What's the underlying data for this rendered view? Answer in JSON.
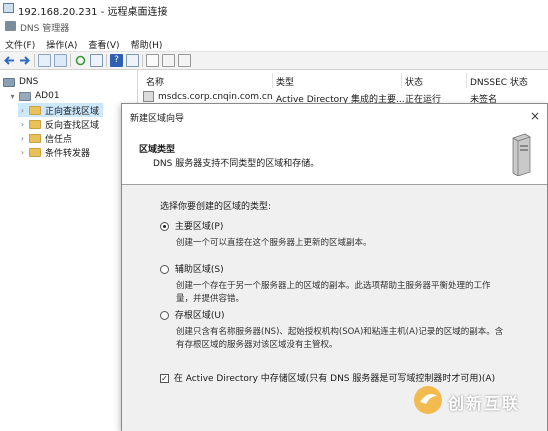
{
  "rdp": {
    "title": "192.168.20.231 - 远程桌面连接"
  },
  "mmc": {
    "title": "DNS 管理器"
  },
  "menu": [
    "文件(F)",
    "操作(A)",
    "查看(V)",
    "帮助(H)"
  ],
  "tree": {
    "root": "DNS",
    "server": "AD01",
    "items": [
      "正向查找区域",
      "反向查找区域",
      "信任点",
      "条件转发器"
    ]
  },
  "list": {
    "columns": [
      "名称",
      "类型",
      "状态",
      "DNSSEC 状态"
    ],
    "rows": [
      {
        "name": "msdcs.corp.cnqin.com.cn",
        "type": "Active Directory 集成的主要...",
        "status": "正在运行",
        "dnssec": "未签名"
      }
    ]
  },
  "dialog": {
    "title": "新建区域向导",
    "close": "×",
    "header_title": "区域类型",
    "header_desc": "DNS 服务器支持不同类型的区域和存储。",
    "prompt": "选择你要创建的区域的类型:",
    "options": [
      {
        "label": "主要区域(P)",
        "selected": true,
        "desc": "创建一个可以直接在这个服务器上更新的区域副本。"
      },
      {
        "label": "辅助区域(S)",
        "selected": false,
        "desc1": "创建一个存在于另一个服务器上的区域的副本。此选项帮助主服务器平衡处理的工作",
        "desc2": "量，并提供容错。"
      },
      {
        "label": "存根区域(U)",
        "selected": false,
        "desc1": "创建只含有名称服务器(NS)、起始授权机构(SOA)和粘连主机(A)记录的区域的副本。含",
        "desc2": "有存根区域的服务器对该区域没有主管权。"
      }
    ],
    "ad_checkbox": {
      "label": "在 Active Directory 中存储区域(只有 DNS 服务器是可写域控制器时才可用)(A)",
      "checked": true
    }
  },
  "watermark": {
    "text": "创新互联"
  },
  "colors": {
    "accent": "#1f6fbf",
    "selection": "#cce8ff",
    "folder": "#e8c15a"
  }
}
